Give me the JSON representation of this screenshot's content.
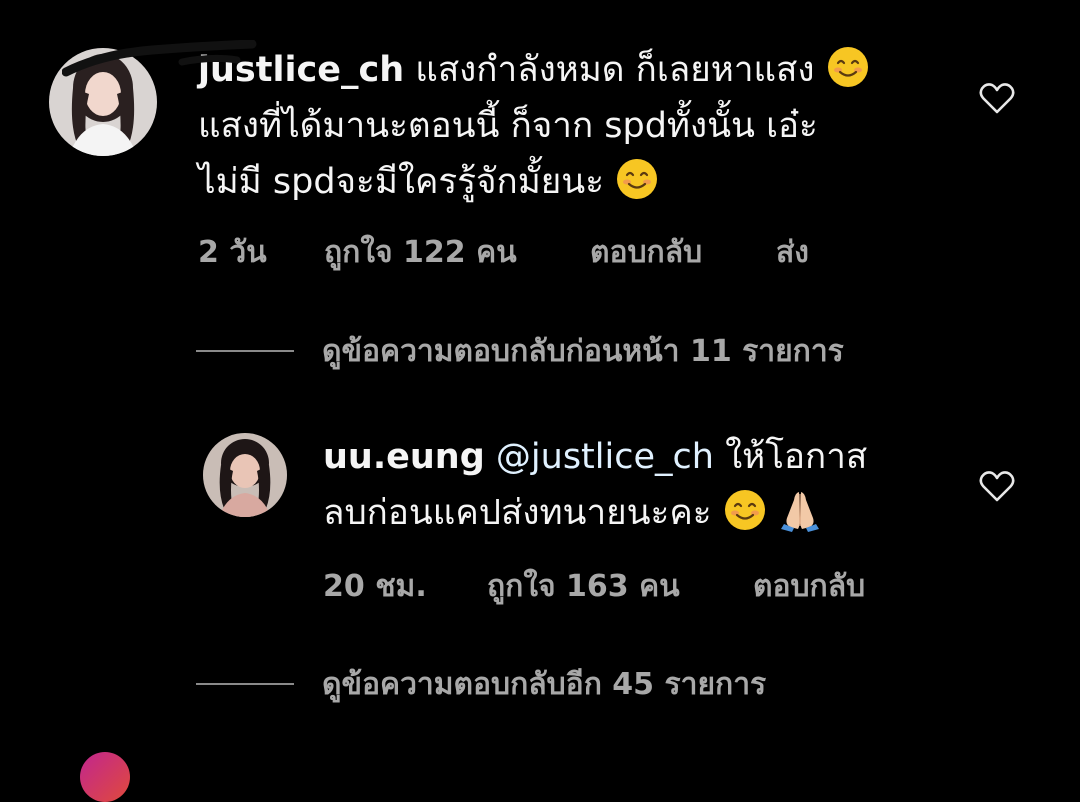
{
  "comment": {
    "username": "justlice_ch",
    "lines": [
      "แสงกำลังหมด ก็เลยหาแสง",
      "แสงที่ได้มานะตอนนี้ ก็จาก spdทั้งนั้น เอ๋ะ",
      "ไม่มี spdจะมีใครรู้จักมั้ยนะ"
    ],
    "time": "2 วัน",
    "likes": "ถูกใจ 122 คน",
    "reply": "ตอบกลับ",
    "send": "ส่ง",
    "emoji": "smiling-face-icon"
  },
  "view_previous": "ดูข้อความตอบกลับก่อนหน้า 11 รายการ",
  "reply": {
    "username": "uu.eung",
    "mention": "@justlice_ch",
    "line1_rest": "ให้โอกาส",
    "line2": "ลบก่อนแคปส่งทนายนะคะ",
    "time": "20 ชม.",
    "likes": "ถูกใจ 163 คน",
    "reply": "ตอบกลับ",
    "emojis": [
      "smiling-face-icon",
      "folded-hands-icon"
    ]
  },
  "view_more": "ดูข้อความตอบกลับอีก 45 รายการ",
  "colors": {
    "background": "#000000",
    "text": "#f5f5f5",
    "meta": "#a8a8a8",
    "emoji_yellow": "#f7c623"
  }
}
